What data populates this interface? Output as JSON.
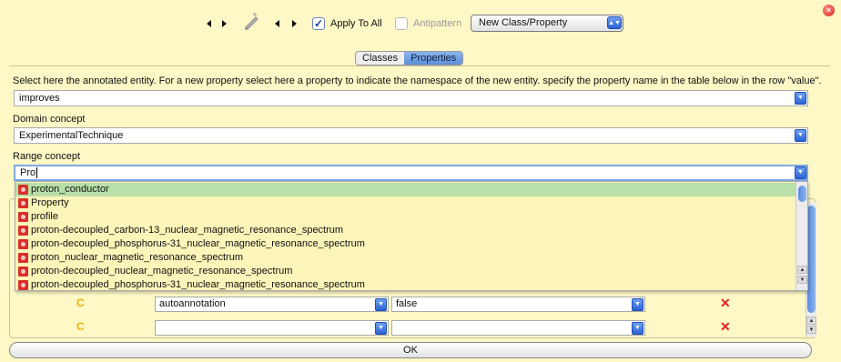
{
  "toolbar": {
    "apply_to_all_label": "Apply To All",
    "apply_to_all_checked": true,
    "antipattern_label": "Antipattern",
    "antipattern_checked": false,
    "mode_select_value": "New Class/Property"
  },
  "tabs": [
    {
      "label": "Classes",
      "active": false
    },
    {
      "label": "Properties",
      "active": true
    }
  ],
  "form": {
    "instruction": "Select here the annotated entity. For a new property select here a property to indicate the namespace of the new entity. specify the property name in the table below in the row \"value\".",
    "entity_value": "improves",
    "domain_label": "Domain concept",
    "domain_value": "ExperimentalTechnique",
    "range_label": "Range concept",
    "range_value": "Pro"
  },
  "suggestions": [
    {
      "label": "proton_conductor",
      "highlighted": true
    },
    {
      "label": "Property",
      "highlighted": false
    },
    {
      "label": "profile",
      "highlighted": false
    },
    {
      "label": "proton-decoupled_carbon-13_nuclear_magnetic_resonance_spectrum",
      "highlighted": false
    },
    {
      "label": "proton-decoupled_phosphorus-31_nuclear_magnetic_resonance_spectrum",
      "highlighted": false
    },
    {
      "label": "proton_nuclear_magnetic_resonance_spectrum",
      "highlighted": false
    },
    {
      "label": "proton-decoupled_nuclear_magnetic_resonance_spectrum",
      "highlighted": false
    },
    {
      "label": "proton-decoupled_phosphorus-31_nuclear_magnetic_resonance_spectrum",
      "highlighted": false
    }
  ],
  "table_rows": [
    {
      "type_letter": "C",
      "property": "autoannotation",
      "value": "false",
      "delete": "✕"
    },
    {
      "type_letter": "C",
      "property": "",
      "value": "",
      "delete": "✕"
    }
  ],
  "ok_label": "OK",
  "colors": {
    "background": "#fdf8c6",
    "highlight": "#b8e0a8",
    "accent_blue": "#2a64d6",
    "delete_red": "#e02020"
  }
}
